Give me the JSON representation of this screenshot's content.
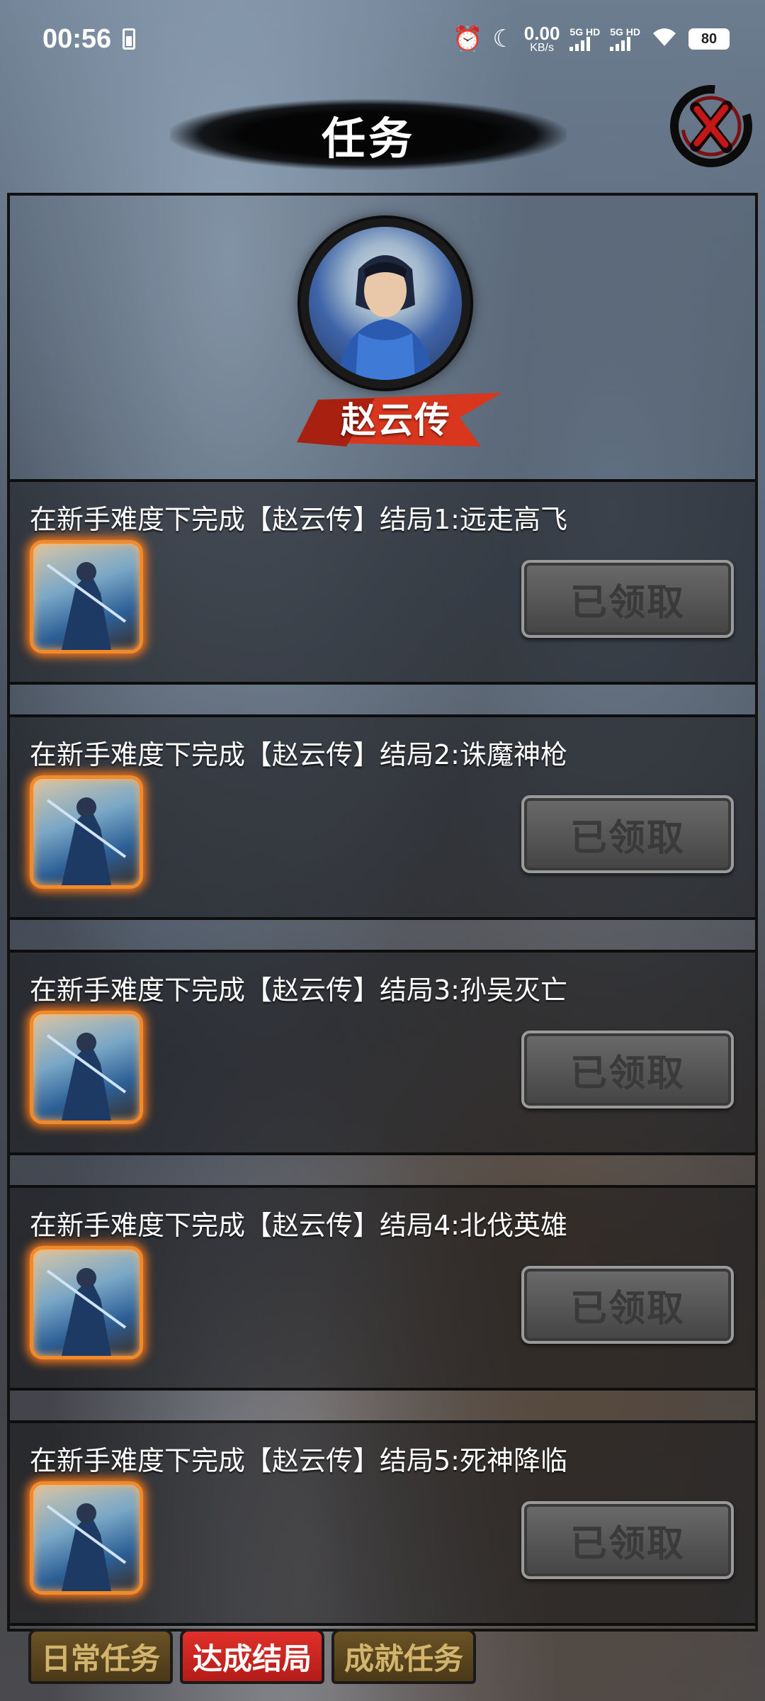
{
  "status_bar": {
    "time": "00:56",
    "net_speed_value": "0.00",
    "net_speed_unit": "KB/s",
    "sim1_label": "5G HD",
    "sim2_label": "5G HD",
    "battery_level": "80"
  },
  "header": {
    "title": "任务"
  },
  "hero": {
    "name": "赵云传"
  },
  "tasks": [
    {
      "title": "在新手难度下完成【赵云传】结局1:远走高飞",
      "button_label": "已领取"
    },
    {
      "title": "在新手难度下完成【赵云传】结局2:诛魔神枪",
      "button_label": "已领取"
    },
    {
      "title": "在新手难度下完成【赵云传】结局3:孙吴灭亡",
      "button_label": "已领取"
    },
    {
      "title": "在新手难度下完成【赵云传】结局4:北伐英雄",
      "button_label": "已领取"
    },
    {
      "title": "在新手难度下完成【赵云传】结局5:死神降临",
      "button_label": "已领取"
    }
  ],
  "tabs": [
    {
      "label": "日常任务",
      "active": false
    },
    {
      "label": "达成结局",
      "active": true
    },
    {
      "label": "成就任务",
      "active": false
    }
  ],
  "colors": {
    "active_tab": "#d6261f",
    "inactive_tab": "#5a4420",
    "reward_glow": "#ff7a1a"
  }
}
